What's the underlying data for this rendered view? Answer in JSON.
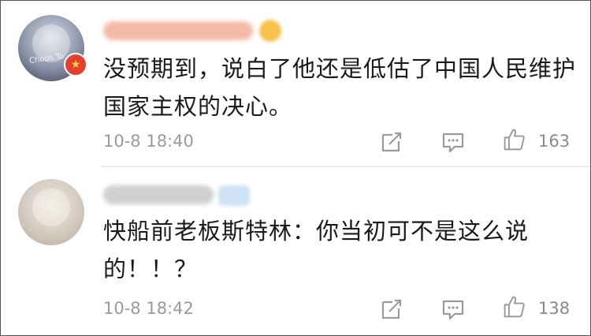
{
  "comments": [
    {
      "avatar_text": "Choos To",
      "text": "没预期到，说白了他还是低估了中国人民维护国家主权的决心。",
      "time": "10-8 18:40",
      "likes": "163"
    },
    {
      "text": "快船前老板斯特林：你当初可不是这么说的！！？",
      "time": "10-8 18:42",
      "likes": "138"
    }
  ],
  "icons": {
    "share": "share-icon",
    "comment": "comment-icon",
    "like": "like-icon",
    "badge": "star-badge-icon"
  },
  "colors": {
    "text": "#1a1a1a",
    "meta": "#9a9a9a",
    "icon": "#9a9a9a",
    "badge": "#e2412f"
  }
}
